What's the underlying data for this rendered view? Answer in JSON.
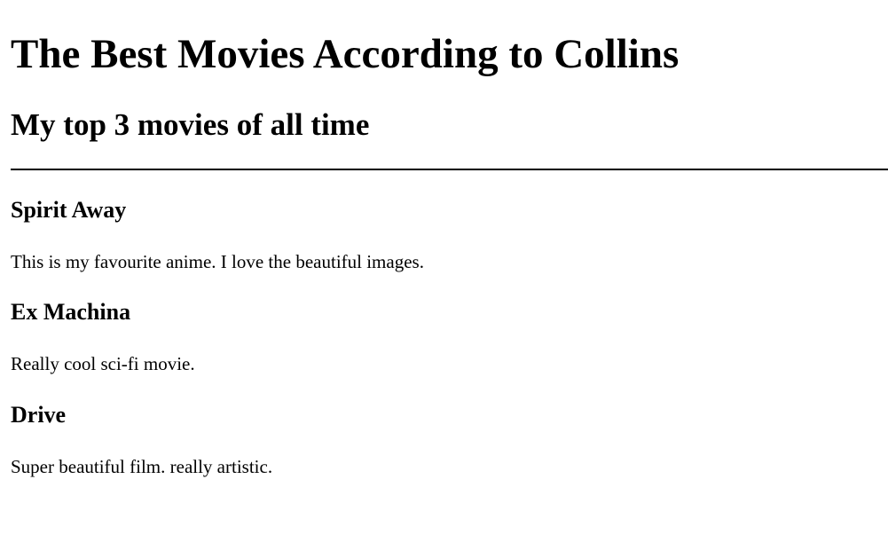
{
  "header": {
    "title": "The Best Movies According to Collins",
    "subtitle": "My top 3 movies of all time"
  },
  "movies": [
    {
      "title": "Spirit Away",
      "description": "This is my favourite anime. I love the beautiful images."
    },
    {
      "title": "Ex Machina",
      "description": "Really cool sci-fi movie."
    },
    {
      "title": "Drive",
      "description": "Super beautiful film. really artistic."
    }
  ],
  "colors": {
    "background": "#ffffff",
    "text": "#000000"
  }
}
